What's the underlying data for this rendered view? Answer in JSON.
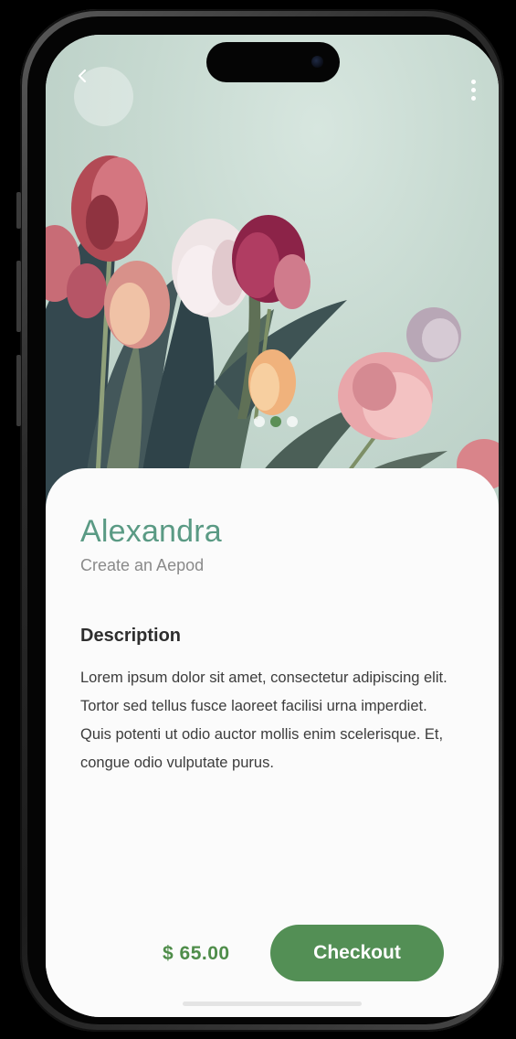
{
  "app": {
    "accent_color": "#538f55",
    "title_color": "#5a9a84"
  },
  "header": {
    "back_icon": "chevron-left-icon",
    "more_icon": "more-vertical-icon"
  },
  "hero": {
    "image": "pink-tulips-photo",
    "pager_count": 3,
    "pager_active": 1
  },
  "product": {
    "name": "Alexandra",
    "subtitle": "Create an Aepod",
    "description_heading": "Description",
    "description": "Lorem ipsum dolor sit amet, consectetur adipiscing elit. Tortor sed tellus fusce laoreet facilisi urna imperdiet. Quis potenti ut odio auctor mollis enim scelerisque. Et, congue odio vulputate purus.",
    "price": "$ 65.00"
  },
  "actions": {
    "checkout_label": "Checkout"
  }
}
